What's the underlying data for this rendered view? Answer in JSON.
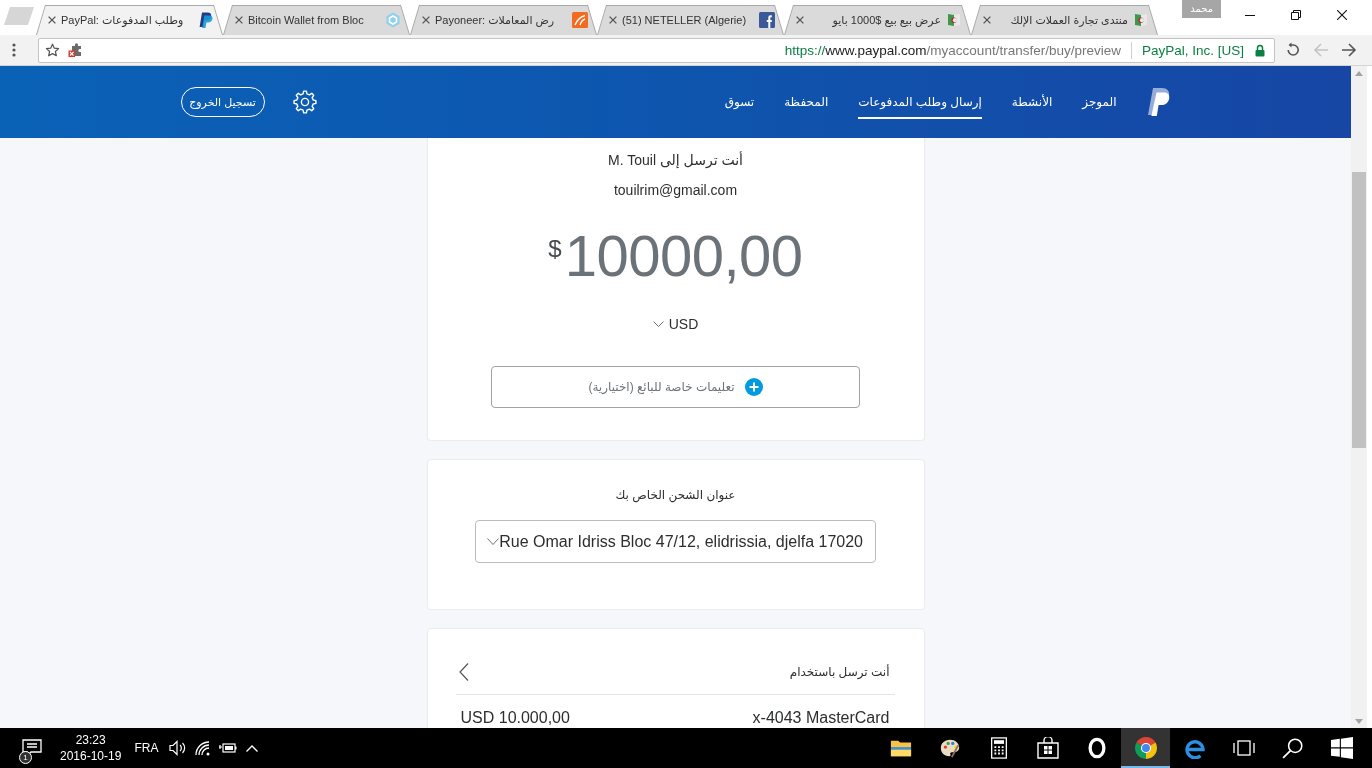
{
  "browser": {
    "tabs": [
      {
        "title": "منتدى تجارة العملات الإلك",
        "kind": "flag",
        "selected": false
      },
      {
        "title": "عرض بيع بيع $1000 بايو",
        "kind": "flag",
        "selected": false
      },
      {
        "title": "(51) NETELLER (Algerie)",
        "kind": "f-tile",
        "selected": false
      },
      {
        "title": "Payoneer: رض المعاملات",
        "kind": "curve-tile",
        "selected": false
      },
      {
        "title": "Bitcoin Wallet from Bloc",
        "kind": "hexagon",
        "selected": false
      },
      {
        "title": "PayPal: وطلب المدفوعات",
        "kind": "logo",
        "selected": true
      }
    ],
    "profile": "محمد",
    "address_bar": {
      "scheme": "https://",
      "host": "www.paypal.com",
      "path": "/myaccount/transfer/buy/preview",
      "identity": "PayPal, Inc. [US]"
    },
    "nav_buttons": [
      {
        "kind": "reload",
        "disabled": false
      },
      {
        "kind": "arrow-left",
        "disabled": true
      },
      {
        "kind": "arrow-right",
        "disabled": false
      }
    ]
  },
  "header": {
    "nav_items": [
      {
        "label": "الموجز",
        "selected": false
      },
      {
        "label": "الأنشطة",
        "selected": false
      },
      {
        "label": "إرسال وطلب المدفوعات",
        "selected": true
      },
      {
        "label": "المحفظة",
        "selected": false
      },
      {
        "label": "تسوق",
        "selected": false
      }
    ],
    "logout": "تسجيل الخروج"
  },
  "payment": {
    "recipient": "أنت ترسل إلى M. Touil",
    "email": "touilrim@gmail.com",
    "currency_symbol": "$",
    "amount": "10000,00",
    "currency": "USD",
    "notes_button": "تعليمات خاصة للبائع (اختيارية)"
  },
  "shipping": {
    "label": "عنوان الشحن الخاص بك",
    "address": "Rue Omar Idriss Bloc 47/12, elidrissia, djelfa 17020"
  },
  "funding": {
    "title": "أنت ترسل باستخدام",
    "amount": "USD 10.000,00",
    "card": "x-4043 MasterCard"
  },
  "taskbar": {
    "notification_count": "1",
    "time": "23:23",
    "date": "2016-10-19",
    "language": "FRA",
    "apps": [
      {
        "kind": "folder",
        "selected": false
      },
      {
        "kind": "palette",
        "selected": false
      },
      {
        "kind": "calculator",
        "selected": false
      },
      {
        "kind": "bag",
        "selected": false
      },
      {
        "kind": "ring",
        "selected": false
      },
      {
        "kind": "round-logo",
        "selected": true
      },
      {
        "kind": "e-logo",
        "selected": false
      },
      {
        "kind": "task-view",
        "selected": false
      },
      {
        "kind": "search",
        "selected": false
      },
      {
        "kind": "start",
        "selected": false
      }
    ]
  }
}
